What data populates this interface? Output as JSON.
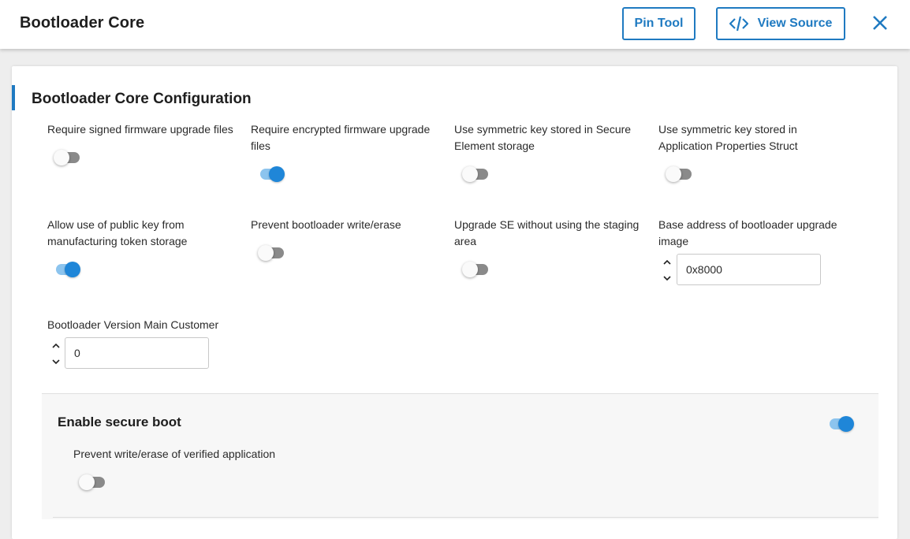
{
  "header": {
    "title": "Bootloader Core",
    "pin_tool_label": "Pin Tool",
    "view_source_label": "View Source",
    "accent_color": "#1f7ac1"
  },
  "card": {
    "title": "Bootloader Core Configuration"
  },
  "fields": {
    "signed_fw": {
      "label": "Require signed firmware upgrade files",
      "enabled": false
    },
    "encrypted_fw": {
      "label": "Require encrypted firmware upgrade files",
      "enabled": true
    },
    "sym_key_se": {
      "label": "Use symmetric key stored in Secure Element storage",
      "enabled": false
    },
    "sym_key_app": {
      "label": "Use symmetric key stored in Application Properties Struct",
      "enabled": false
    },
    "public_key_token": {
      "label": "Allow use of public key from manufacturing token storage",
      "enabled": true
    },
    "prevent_bl_write": {
      "label": "Prevent bootloader write/erase",
      "enabled": false
    },
    "upgrade_se": {
      "label": "Upgrade SE without using the staging area",
      "enabled": false
    },
    "base_address": {
      "label": "Base address of bootloader upgrade image",
      "value": "0x8000"
    },
    "version_main": {
      "label": "Bootloader Version Main Customer",
      "value": "0"
    }
  },
  "secure_boot": {
    "title": "Enable secure boot",
    "enabled": true,
    "prevent_write_label": "Prevent write/erase of verified application",
    "prevent_write_enabled": false
  },
  "icons": {
    "view_source": "code-icon",
    "close": "close-icon",
    "spinner_up": "chevron-up-icon",
    "spinner_down": "chevron-down-icon"
  }
}
